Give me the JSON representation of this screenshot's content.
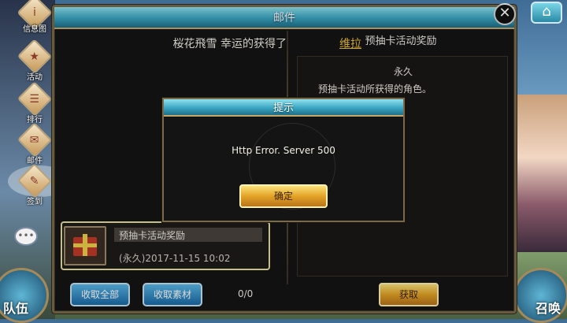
{
  "window": {
    "title": "邮件"
  },
  "home_icon": "home-icon",
  "close_icon": "close-icon",
  "sidebar": {
    "items": [
      {
        "label": "信息图",
        "icon": "info-icon"
      },
      {
        "label": "活动",
        "icon": "event-icon"
      },
      {
        "label": "排行",
        "icon": "ranking-icon"
      },
      {
        "label": "邮件",
        "icon": "mail-icon"
      },
      {
        "label": "签到",
        "icon": "checkin-icon"
      }
    ],
    "chat_icon": "chat-icon"
  },
  "corners": {
    "left_label": "队伍",
    "right_label": "召唤"
  },
  "announcement": {
    "prefix": "桜花飛雪 幸运的获得了",
    "highlight": "维拉"
  },
  "mail_list": {
    "items": [
      {
        "title": "预抽卡活动奖励",
        "date": "(永久)2017-11-15 10:02",
        "icon": "gift-icon"
      }
    ],
    "buttons": {
      "collect_all": "收取全部",
      "collect_materials": "收取素材"
    },
    "count": "0/0"
  },
  "detail": {
    "title": "预抽卡活动奖励",
    "duration": "永久",
    "description": "预抽卡活动所获得的角色。",
    "claim_button": "获取"
  },
  "dialog": {
    "title": "提示",
    "message": "Http Error. Server 500",
    "confirm_button": "确定"
  },
  "colors": {
    "title_bar": "#3aa6c2",
    "highlight_name": "#f2c23a",
    "gold_button": "#e3a326",
    "blue_button": "#1a6aa8",
    "selected_border": "#e8e2a0"
  }
}
